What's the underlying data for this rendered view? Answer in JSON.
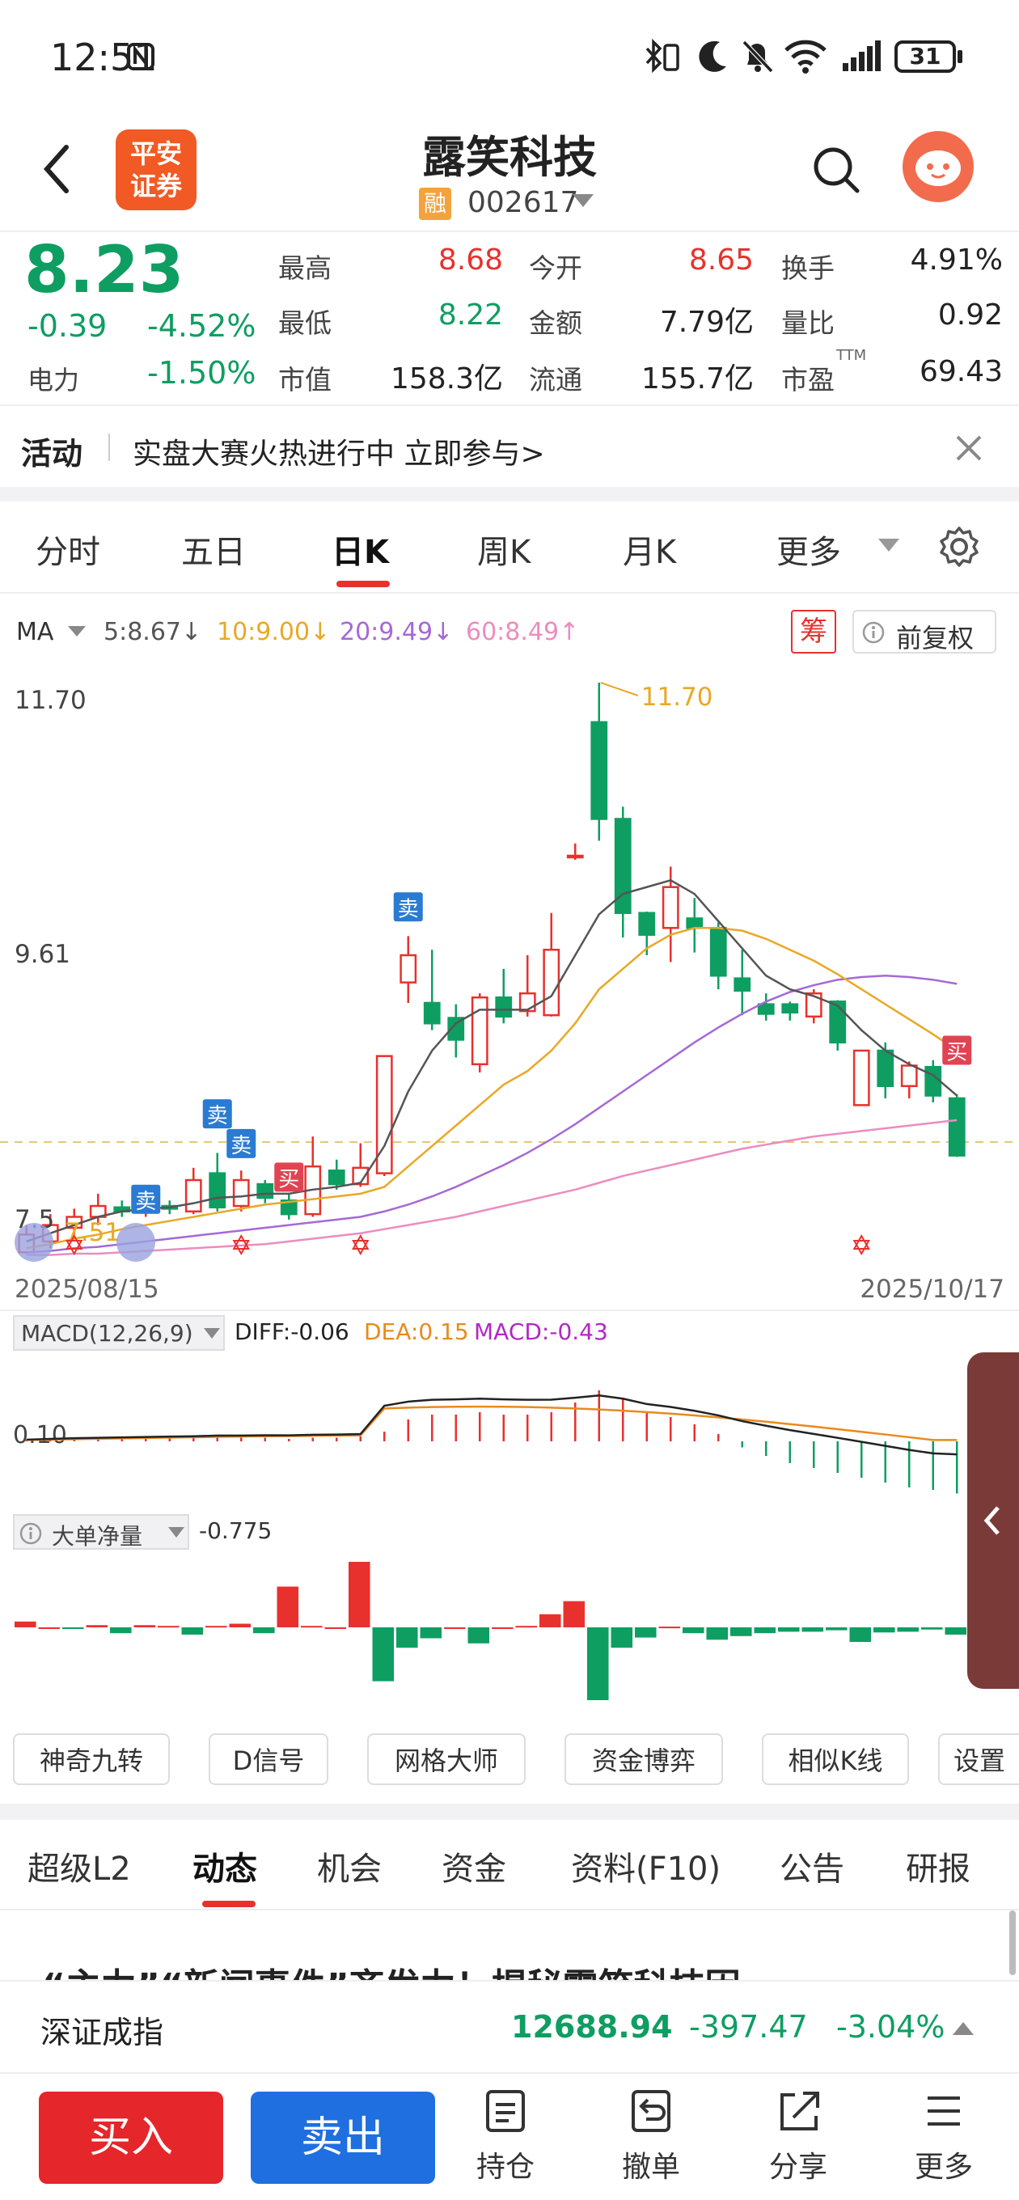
{
  "status_bar": {
    "time": "12:51",
    "battery": "31"
  },
  "header": {
    "stock_name": "露笑科技",
    "broker_line1": "平安",
    "broker_line2": "证券",
    "rong": "融",
    "code": "002617"
  },
  "quote": {
    "price": "8.23",
    "change": "-0.39",
    "change_pct": "-4.52%",
    "sector_name": "电力",
    "sector_pct": "-1.50%",
    "high_lbl": "最高",
    "high": "8.68",
    "low_lbl": "最低",
    "low": "8.22",
    "mcap_lbl": "市值",
    "mcap": "158.3亿",
    "open_lbl": "今开",
    "open": "8.65",
    "amount_lbl": "金额",
    "amount": "7.79亿",
    "float_lbl": "流通",
    "float": "155.7亿",
    "turnover_lbl": "换手",
    "turnover": "4.91%",
    "vol_ratio_lbl": "量比",
    "vol_ratio": "0.92",
    "pe_lbl": "市盈",
    "pe_sup": "TTM",
    "pe": "69.43"
  },
  "banner": {
    "tag": "活动",
    "text": "实盘大赛火热进行中 立即参与>"
  },
  "period_tabs": [
    "分时",
    "五日",
    "日K",
    "周K",
    "月K",
    "更多"
  ],
  "active_tab": 2,
  "ma_legend": {
    "title": "MA",
    "ma5": "5:8.67↓",
    "ma10": "10:9.00↓",
    "ma20": "20:9.49↓",
    "ma60": "60:8.49↑",
    "chip": "筹",
    "adjust": "前复权"
  },
  "colors": {
    "up": "#e8312d",
    "down": "#0e9e62",
    "ma5": "#555555",
    "ma10": "#e9a825",
    "ma20": "#a569d6",
    "ma60": "#ec8cbf",
    "macd_dea": "#e98a1c",
    "accent": "#e8312d"
  },
  "kline": {
    "y_top_label": "11.70",
    "y_mid_label": "9.61",
    "y_low_label": "7.5",
    "low_marker": "7.51",
    "high_marker": "11.70",
    "date_start": "2025/08/15",
    "date_end": "2025/10/17",
    "signals": {
      "sell": "卖",
      "buy": "买"
    }
  },
  "chart_data": {
    "type": "candlestick",
    "x_start": "2025/08/15",
    "x_end": "2025/10/17",
    "ylim": [
      7.51,
      11.7
    ],
    "candles": [
      {
        "o": 7.52,
        "c": 7.65,
        "h": 7.72,
        "l": 7.51
      },
      {
        "o": 7.6,
        "c": 7.72,
        "h": 7.8,
        "l": 7.55
      },
      {
        "o": 7.7,
        "c": 7.78,
        "h": 7.84,
        "l": 7.65
      },
      {
        "o": 7.78,
        "c": 7.86,
        "h": 7.95,
        "l": 7.72
      },
      {
        "o": 7.85,
        "c": 7.82,
        "h": 7.9,
        "l": 7.78
      },
      {
        "o": 7.82,
        "c": 7.88,
        "h": 7.93,
        "l": 7.78
      },
      {
        "o": 7.86,
        "c": 7.84,
        "h": 7.9,
        "l": 7.8
      },
      {
        "o": 7.82,
        "c": 8.05,
        "h": 8.14,
        "l": 7.8
      },
      {
        "o": 8.1,
        "c": 7.85,
        "h": 8.25,
        "l": 7.82
      },
      {
        "o": 7.86,
        "c": 8.05,
        "h": 8.12,
        "l": 7.82
      },
      {
        "o": 8.02,
        "c": 7.92,
        "h": 8.05,
        "l": 7.88
      },
      {
        "o": 7.9,
        "c": 7.8,
        "h": 7.95,
        "l": 7.76
      },
      {
        "o": 7.8,
        "c": 8.15,
        "h": 8.37,
        "l": 7.78
      },
      {
        "o": 8.12,
        "c": 8.02,
        "h": 8.2,
        "l": 7.98
      },
      {
        "o": 8.02,
        "c": 8.14,
        "h": 8.32,
        "l": 8.0
      },
      {
        "o": 8.1,
        "c": 8.96,
        "h": 8.96,
        "l": 8.08
      },
      {
        "o": 9.5,
        "c": 9.7,
        "h": 9.84,
        "l": 9.35
      },
      {
        "o": 9.35,
        "c": 9.2,
        "h": 9.74,
        "l": 9.15
      },
      {
        "o": 9.24,
        "c": 9.08,
        "h": 9.34,
        "l": 8.95
      },
      {
        "o": 8.9,
        "c": 9.39,
        "h": 9.42,
        "l": 8.84
      },
      {
        "o": 9.39,
        "c": 9.25,
        "h": 9.6,
        "l": 9.2
      },
      {
        "o": 9.29,
        "c": 9.42,
        "h": 9.7,
        "l": 9.25
      },
      {
        "o": 9.26,
        "c": 9.74,
        "h": 10.01,
        "l": 9.25
      },
      {
        "o": 10.43,
        "c": 10.43,
        "h": 10.52,
        "l": 10.4
      },
      {
        "o": 11.41,
        "c": 10.7,
        "h": 11.7,
        "l": 10.54
      },
      {
        "o": 10.7,
        "c": 10.01,
        "h": 10.79,
        "l": 9.83
      },
      {
        "o": 10.01,
        "c": 9.85,
        "h": 10.02,
        "l": 9.7
      },
      {
        "o": 9.9,
        "c": 10.2,
        "h": 10.35,
        "l": 9.65
      },
      {
        "o": 9.97,
        "c": 9.9,
        "h": 10.12,
        "l": 9.72
      },
      {
        "o": 9.9,
        "c": 9.55,
        "h": 9.94,
        "l": 9.45
      },
      {
        "o": 9.53,
        "c": 9.44,
        "h": 9.74,
        "l": 9.26
      },
      {
        "o": 9.34,
        "c": 9.27,
        "h": 9.42,
        "l": 9.22
      },
      {
        "o": 9.34,
        "c": 9.28,
        "h": 9.36,
        "l": 9.22
      },
      {
        "o": 9.25,
        "c": 9.42,
        "h": 9.45,
        "l": 9.2
      },
      {
        "o": 9.36,
        "c": 9.06,
        "h": 9.37,
        "l": 9.0
      },
      {
        "o": 8.6,
        "c": 9.0,
        "h": 9.0,
        "l": 8.6
      },
      {
        "o": 9.0,
        "c": 8.74,
        "h": 9.06,
        "l": 8.65
      },
      {
        "o": 8.74,
        "c": 8.89,
        "h": 8.92,
        "l": 8.65
      },
      {
        "o": 8.88,
        "c": 8.67,
        "h": 8.93,
        "l": 8.62
      },
      {
        "o": 8.65,
        "c": 8.23,
        "h": 8.68,
        "l": 8.22
      }
    ],
    "ma5": [
      7.6,
      7.66,
      7.72,
      7.78,
      7.82,
      7.84,
      7.85,
      7.88,
      7.92,
      7.93,
      7.95,
      7.95,
      7.98,
      8.0,
      8.03,
      8.3,
      8.7,
      9.0,
      9.2,
      9.3,
      9.3,
      9.3,
      9.4,
      9.7,
      10.0,
      10.15,
      10.2,
      10.25,
      10.15,
      9.95,
      9.75,
      9.55,
      9.45,
      9.4,
      9.33,
      9.15,
      9.0,
      8.9,
      8.82,
      8.67
    ],
    "ma10": [
      7.55,
      7.58,
      7.62,
      7.65,
      7.69,
      7.72,
      7.75,
      7.78,
      7.81,
      7.84,
      7.87,
      7.89,
      7.91,
      7.93,
      7.95,
      8.0,
      8.15,
      8.3,
      8.45,
      8.6,
      8.75,
      8.85,
      9.0,
      9.2,
      9.45,
      9.6,
      9.75,
      9.85,
      9.9,
      9.9,
      9.88,
      9.82,
      9.74,
      9.66,
      9.56,
      9.45,
      9.34,
      9.23,
      9.12,
      9.0
    ],
    "ma20": [
      7.52,
      7.53,
      7.55,
      7.56,
      7.58,
      7.6,
      7.62,
      7.64,
      7.66,
      7.68,
      7.7,
      7.72,
      7.74,
      7.76,
      7.78,
      7.82,
      7.87,
      7.93,
      8.0,
      8.08,
      8.16,
      8.25,
      8.35,
      8.46,
      8.58,
      8.7,
      8.82,
      8.94,
      9.06,
      9.17,
      9.27,
      9.36,
      9.43,
      9.48,
      9.52,
      9.54,
      9.55,
      9.54,
      9.52,
      9.49
    ],
    "ma60": [
      7.5,
      7.5,
      7.51,
      7.51,
      7.52,
      7.53,
      7.54,
      7.55,
      7.56,
      7.57,
      7.58,
      7.6,
      7.62,
      7.64,
      7.66,
      7.69,
      7.72,
      7.75,
      7.78,
      7.82,
      7.86,
      7.9,
      7.94,
      7.98,
      8.03,
      8.08,
      8.12,
      8.16,
      8.2,
      8.24,
      8.28,
      8.31,
      8.34,
      8.37,
      8.39,
      8.41,
      8.43,
      8.45,
      8.47,
      8.49
    ],
    "macd": {
      "label": "MACD(12,26,9)",
      "diff": "DIFF:-0.06",
      "dea": "DEA:0.15",
      "macd": "MACD:-0.43",
      "y_label": "0.10",
      "bars": [
        0.01,
        0.02,
        0.03,
        0.03,
        0.03,
        0.03,
        0.03,
        0.03,
        0.04,
        0.03,
        0.03,
        0.02,
        0.03,
        0.03,
        0.04,
        0.08,
        0.18,
        0.22,
        0.22,
        0.24,
        0.22,
        0.22,
        0.24,
        0.32,
        0.42,
        0.36,
        0.24,
        0.2,
        0.14,
        0.06,
        -0.05,
        -0.12,
        -0.18,
        -0.22,
        -0.26,
        -0.3,
        -0.34,
        -0.38,
        -0.4,
        -0.43
      ]
    },
    "big_order": {
      "label": "大单净量",
      "value": "-0.775",
      "bars": [
        0.08,
        0,
        -0.02,
        0.03,
        -0.08,
        0.03,
        0.02,
        -0.1,
        0.02,
        0.05,
        -0.08,
        0.56,
        0.02,
        0,
        0.9,
        -0.74,
        -0.28,
        -0.15,
        0,
        -0.22,
        0,
        0.02,
        0.18,
        0.36,
        -1.0,
        -0.28,
        -0.14,
        0.01,
        -0.08,
        -0.17,
        -0.12,
        -0.08,
        -0.06,
        -0.06,
        -0.04,
        -0.2,
        -0.07,
        -0.06,
        -0.03,
        -0.1
      ]
    }
  },
  "tools": [
    "神奇九转",
    "D信号",
    "网格大师",
    "资金博弈",
    "相似K线",
    "设置"
  ],
  "bottom_tabs": [
    "超级L2",
    "动态",
    "机会",
    "资金",
    "资料(F10)",
    "公告",
    "研报"
  ],
  "bottom_active": 1,
  "news_preview": "“主力”“新闻事件”齐发力！揭秘露笑科技因",
  "index_bar": {
    "name": "深证成指",
    "value": "12688.94",
    "change": "-397.47",
    "pct": "-3.04%"
  },
  "actions": {
    "buy": "买入",
    "sell": "卖出",
    "hold": "持仓",
    "cancel": "撤单",
    "share": "分享",
    "more": "更多"
  }
}
